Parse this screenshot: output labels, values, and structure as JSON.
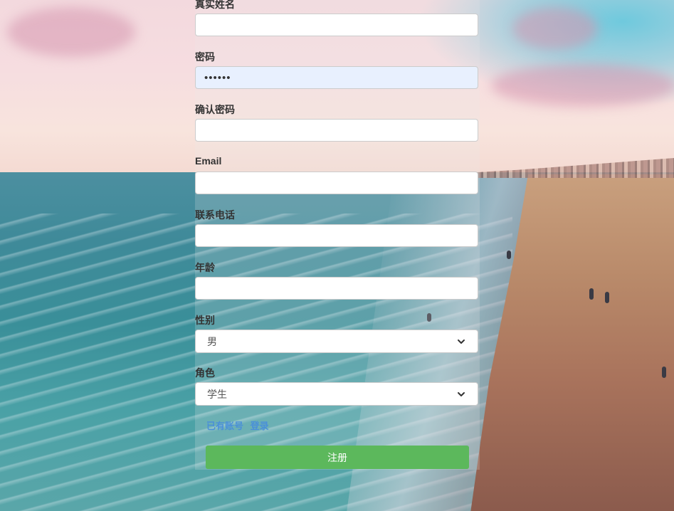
{
  "form": {
    "fields": [
      {
        "label": "真实姓名",
        "value": ""
      },
      {
        "label": "密码",
        "value": "••••••"
      },
      {
        "label": "确认密码",
        "value": ""
      },
      {
        "label": "Email",
        "value": ""
      },
      {
        "label": "联系电话",
        "value": ""
      },
      {
        "label": "年龄",
        "value": ""
      }
    ],
    "gender": {
      "label": "性别",
      "selected": "男"
    },
    "role": {
      "label": "角色",
      "selected": "学生"
    },
    "links": [
      "已有账号",
      "登录"
    ],
    "submit_label": "注册"
  },
  "colors": {
    "submit_button": "#5cb85c",
    "link": "#4a90d9",
    "autofill_input": "#e8f0fe"
  },
  "icons": {
    "select_arrow": "chevron-down-icon"
  }
}
